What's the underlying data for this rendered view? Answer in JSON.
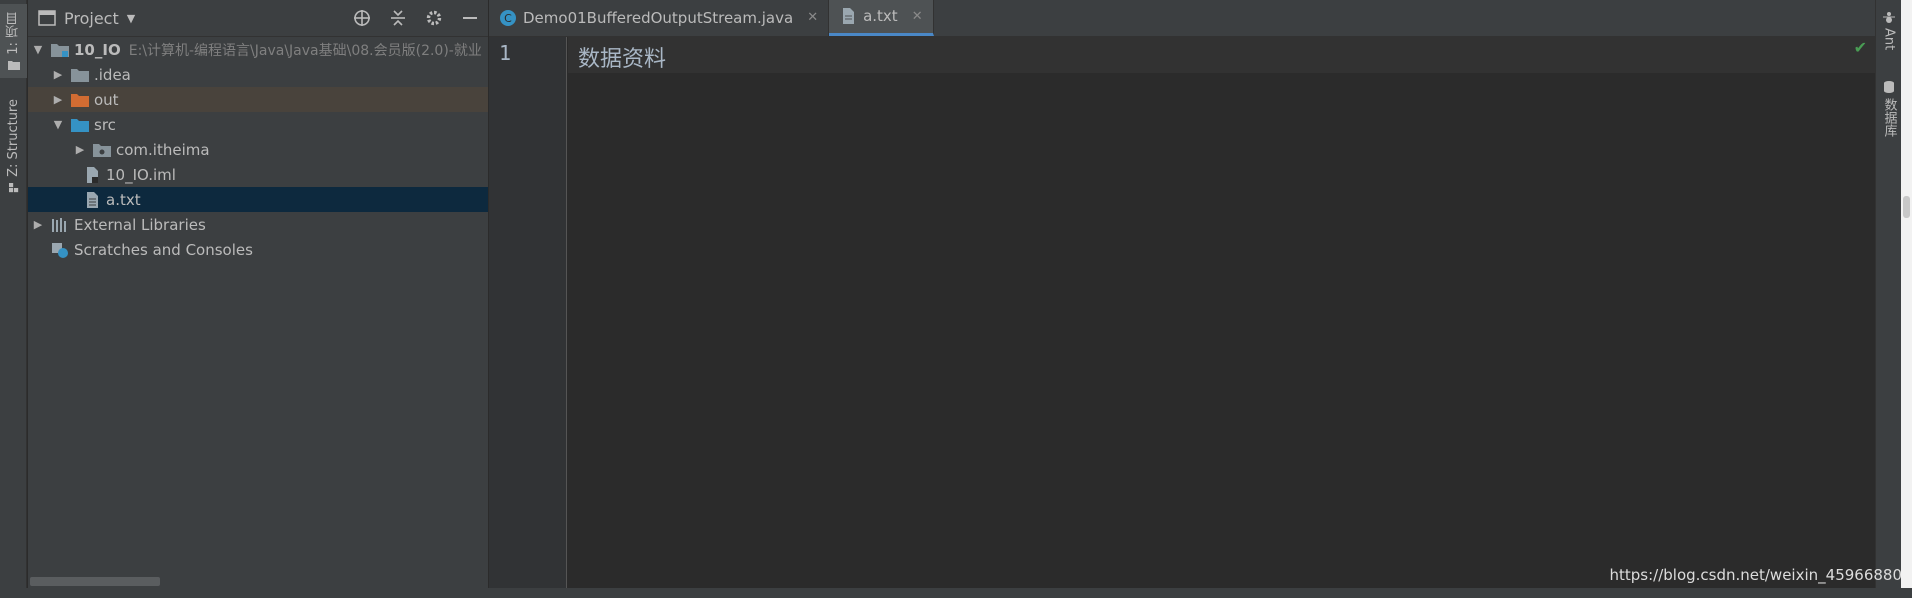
{
  "left_strip": {
    "project_tab_label": "1: 项目",
    "structure_tab_label": "Z: Structure"
  },
  "project_panel": {
    "title": "Project",
    "tools": [
      "crosshair-icon",
      "collapse-all-icon",
      "gear-icon",
      "minimize-icon"
    ],
    "tree": [
      {
        "name": "10_IO",
        "path": "E:\\计算机-编程语言\\Java\\Java基础\\08.会员版(2.0)-就业",
        "expanded": true,
        "icon": "module-folder-icon"
      },
      {
        "name": ".idea",
        "expanded": false,
        "icon": "folder-icon"
      },
      {
        "name": "out",
        "expanded": false,
        "icon": "excluded-folder-icon"
      },
      {
        "name": "src",
        "expanded": true,
        "icon": "source-folder-icon"
      },
      {
        "name": "com.itheima",
        "expanded": false,
        "icon": "package-icon"
      },
      {
        "name": "10_IO.iml",
        "icon": "iml-file-icon"
      },
      {
        "name": "a.txt",
        "icon": "text-file-icon",
        "selected": true
      },
      {
        "name": "External Libraries",
        "expanded": false,
        "icon": "libraries-icon"
      },
      {
        "name": "Scratches and Consoles",
        "icon": "scratches-icon"
      }
    ]
  },
  "editor": {
    "tabs": [
      {
        "label": "Demo01BufferedOutputStream.java",
        "icon": "java-class-icon",
        "active": false
      },
      {
        "label": "a.txt",
        "icon": "text-file-icon",
        "active": true
      }
    ],
    "line_number": "1",
    "line_text": "数据资料",
    "status_icon": "check-icon",
    "colors": {
      "check": "#499c54",
      "tab_underline": "#4a88c7",
      "selected_row": "#0d293e"
    }
  },
  "right_strip": {
    "ant_label": "Ant",
    "database_label": "数据库"
  },
  "watermark": "https://blog.csdn.net/weixin_45966880"
}
